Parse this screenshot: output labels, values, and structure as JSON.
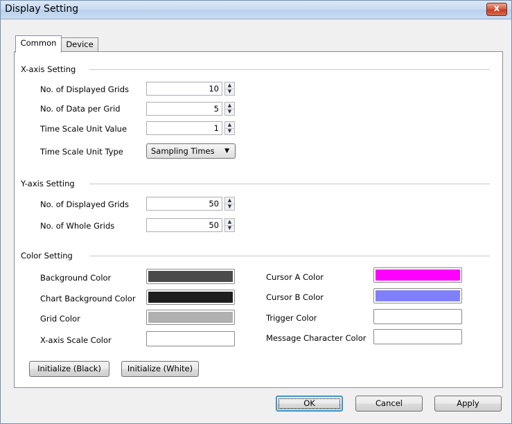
{
  "window": {
    "title": "Display Setting",
    "close_label": "x"
  },
  "tabs": [
    {
      "label": "Common"
    },
    {
      "label": "Device"
    }
  ],
  "x_axis": {
    "group_label": "X-axis Setting",
    "displayed_grids": {
      "label": "No. of Displayed Grids",
      "value": "10"
    },
    "data_per_grid": {
      "label": "No. of Data per Grid",
      "value": "5"
    },
    "time_scale_value": {
      "label": "Time Scale Unit Value",
      "value": "1"
    },
    "time_scale_type": {
      "label": "Time Scale Unit Type",
      "value": "Sampling Times"
    }
  },
  "y_axis": {
    "group_label": "Y-axis Setting",
    "displayed_grids": {
      "label": "No. of Displayed Grids",
      "value": "50"
    },
    "whole_grids": {
      "label": "No. of Whole Grids",
      "value": "50"
    }
  },
  "color_setting": {
    "group_label": "Color Setting",
    "background": {
      "label": "Background Color",
      "color": "#4a4a4a"
    },
    "chart_background": {
      "label": "Chart Background Color",
      "color": "#1e1e1e"
    },
    "grid": {
      "label": "Grid Color",
      "color": "#b0b0b0"
    },
    "x_axis_scale": {
      "label": "X-axis Scale Color",
      "color": "#ffffff"
    },
    "cursor_a": {
      "label": "Cursor A Color",
      "color": "#ff00ff"
    },
    "cursor_b": {
      "label": "Cursor B Color",
      "color": "#8080ff"
    },
    "trigger": {
      "label": "Trigger Color",
      "color": "#ffffff"
    },
    "message_char": {
      "label": "Message Character Color",
      "color": "#ffffff"
    }
  },
  "buttons": {
    "init_black": "Initialize (Black)",
    "init_white": "Initialize (White)",
    "ok": "OK",
    "cancel": "Cancel",
    "apply": "Apply"
  }
}
